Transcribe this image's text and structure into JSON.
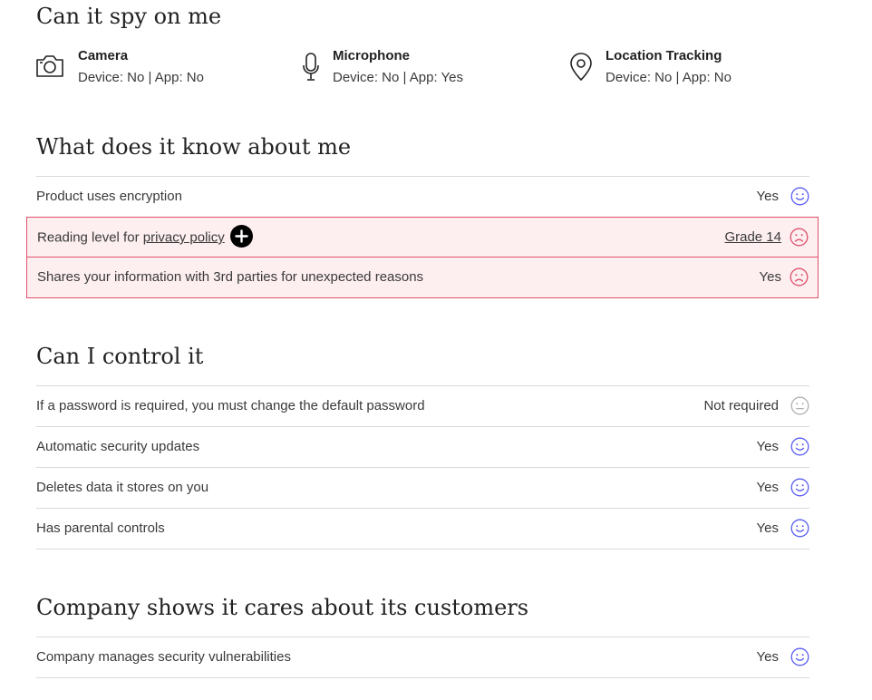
{
  "spy": {
    "heading": "Can it spy on me",
    "items": [
      {
        "title": "Camera",
        "status": "Device: No | App: No",
        "icon": "camera-icon"
      },
      {
        "title": "Microphone",
        "status": "Device: No | App: Yes",
        "icon": "microphone-icon"
      },
      {
        "title": "Location Tracking",
        "status": "Device: No | App: No",
        "icon": "location-pin-icon"
      }
    ]
  },
  "know": {
    "heading": "What does it know about me",
    "rows": [
      {
        "label": "Product uses encryption",
        "value": "Yes",
        "rating": "happy"
      },
      {
        "label_prefix": "Reading level for ",
        "link": "privacy policy",
        "value": "Grade 14",
        "rating": "sad"
      },
      {
        "label": "Shares your information with 3rd parties for unexpected reasons",
        "value": "Yes",
        "rating": "sad"
      }
    ]
  },
  "control": {
    "heading": "Can I control it",
    "rows": [
      {
        "label": "If a password is required, you must change the default password",
        "value": "Not required",
        "rating": "neutral"
      },
      {
        "label": "Automatic security updates",
        "value": "Yes",
        "rating": "happy"
      },
      {
        "label": "Deletes data it stores on you",
        "value": "Yes",
        "rating": "happy"
      },
      {
        "label": "Has parental controls",
        "value": "Yes",
        "rating": "happy"
      }
    ]
  },
  "company": {
    "heading": "Company shows it cares about its customers",
    "rows": [
      {
        "label": "Company manages security vulnerabilities",
        "value": "Yes",
        "rating": "happy"
      }
    ]
  },
  "colors": {
    "happy": "#595cf3",
    "sad": "#e0516b",
    "neutral": "#b0b0b0",
    "bad_row_bg": "#fdeef0",
    "bad_row_border": "#e0516b"
  }
}
